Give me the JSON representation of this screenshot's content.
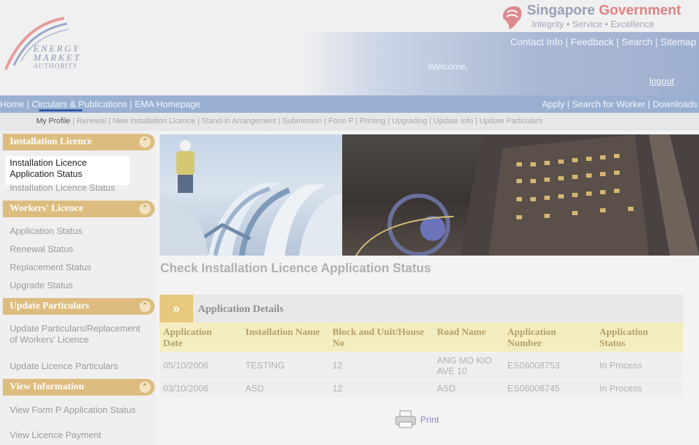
{
  "header": {
    "logo_lines": [
      "ENERGY",
      "MARKET",
      "AUTHORITY"
    ],
    "gov_name_part1": "Singapore",
    "gov_name_part2": "Government",
    "gov_motto": "Integrity • Service • Excellence",
    "top_links": [
      "Contact Info",
      "Feedback",
      "Search",
      "Sitemap"
    ],
    "welcome": "Welcome,",
    "logout": "logout"
  },
  "nav_primary": {
    "left": [
      "Home",
      "Circulars & Publications",
      "EMA Homepage"
    ],
    "right": [
      "Apply",
      "Search for Worker",
      "Downloads"
    ]
  },
  "nav_secondary": {
    "items": [
      "My Profile",
      "Renewal",
      "New Installation Licence",
      "Stand-in Arrangement",
      "Submission",
      "Form P",
      "Printing",
      "Upgrading",
      "Update Info",
      "Update Particulars"
    ],
    "active": "My Profile"
  },
  "sidebar": {
    "installation": {
      "title": "Installation Licence",
      "item1": "Installation Licence Application Status",
      "item2": "Installation Licence Status"
    },
    "workers": {
      "title": "Workers' Licence",
      "items": [
        "Application Status",
        "Renewal Status",
        "Replacement Status",
        "Upgrade Status"
      ]
    },
    "update": {
      "title": "Update Particulars",
      "item1": "Update Particulars/Replacement of Workers' Licence",
      "item2": "Update Licence Particulars"
    },
    "view": {
      "title": "View Information",
      "item1": "View Form P Application Status",
      "item2": "View Licence Payment"
    }
  },
  "main": {
    "title": "Check Installation Licence Application Status",
    "section_title": "Application Details",
    "section_arrow": "»",
    "columns": [
      "Application Date",
      "Installation Name",
      "Block and Unit/House No",
      "Road Name",
      "Application Number",
      "Application Status"
    ],
    "rows": [
      [
        "05/10/2006",
        "TESTING",
        "12",
        "ANG MO KIO AVE 10",
        "ES06008753",
        "In Process"
      ],
      [
        "03/10/2006",
        "ASD",
        "12",
        "ASD",
        "ES06008745",
        "In Process"
      ]
    ],
    "print_label": "Print"
  },
  "colors": {
    "nav_bar": "#9ab0d3",
    "section_gold": "#ddbd7f",
    "table_header": "#f4edbf",
    "print_link": "#8b89c7"
  }
}
